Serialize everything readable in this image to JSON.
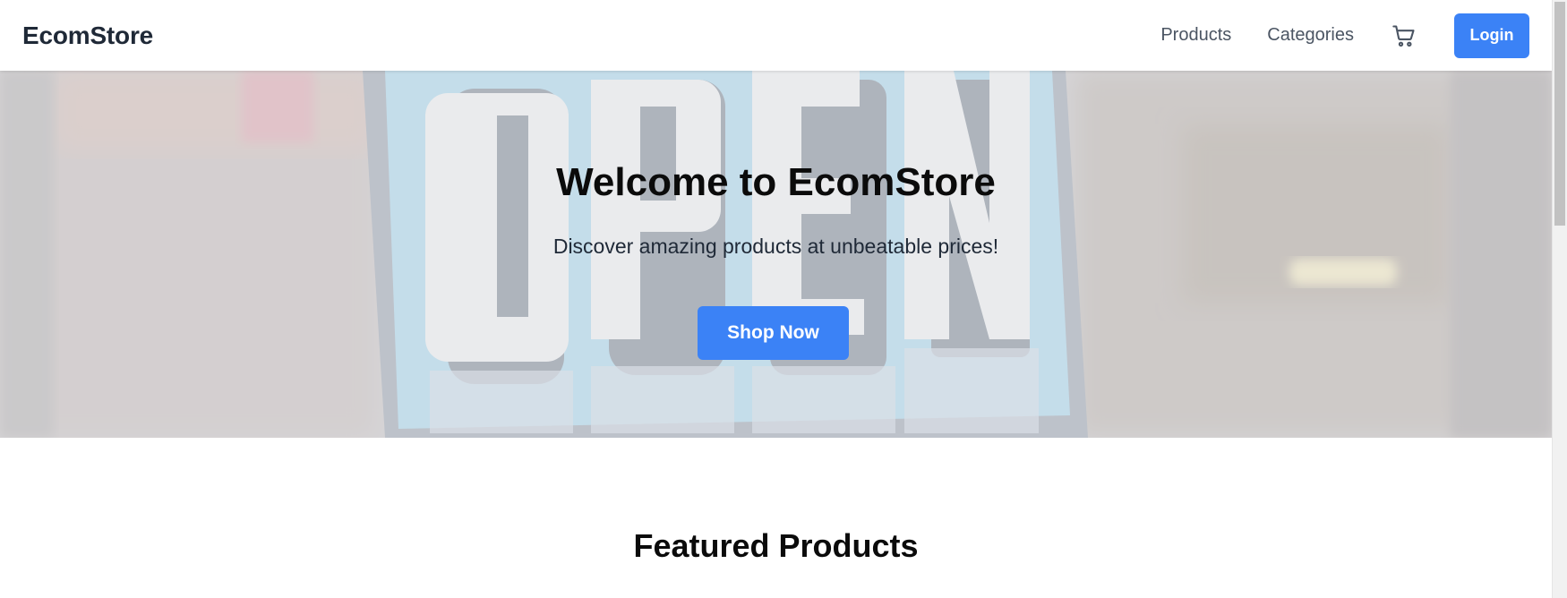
{
  "header": {
    "brand": "EcomStore",
    "nav_links": [
      "Products",
      "Categories"
    ],
    "cart_icon": "shopping-cart-icon",
    "login_label": "Login"
  },
  "hero": {
    "title": "Welcome to EcomStore",
    "subtitle": "Discover amazing products at unbeatable prices!",
    "cta_label": "Shop Now",
    "background_sign_text": "OPEN"
  },
  "featured": {
    "title": "Featured Products"
  },
  "colors": {
    "accent": "#3b82f6",
    "nav_text": "#4b5563",
    "brand_text": "#1f2937"
  }
}
